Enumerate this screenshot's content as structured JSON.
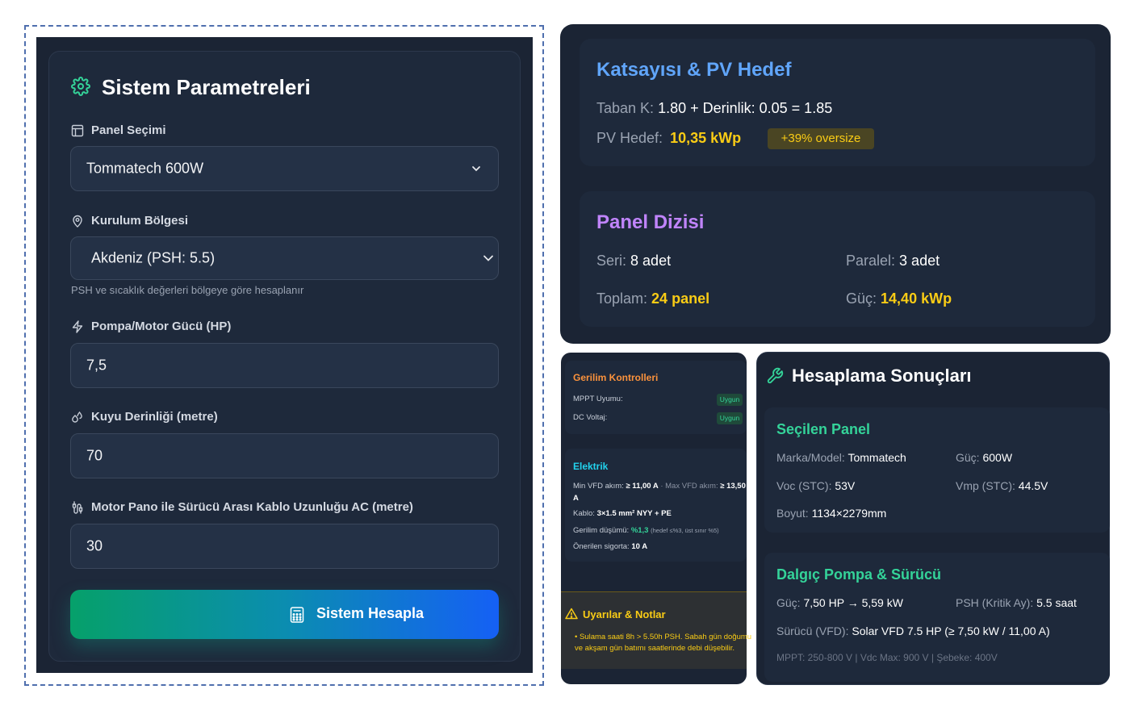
{
  "params": {
    "title": "Sistem Parametreleri",
    "panel": {
      "label": "Panel Seçimi",
      "value": "Tommatech 600W"
    },
    "region": {
      "label": "Kurulum Bölgesi",
      "value": "Akdeniz (PSH: 5.5)",
      "hint": "PSH ve sıcaklık değerleri bölgeye göre hesaplanır"
    },
    "pump": {
      "label": "Pompa/Motor Gücü (HP)",
      "value": "7,5"
    },
    "depth": {
      "label": "Kuyu Derinliği (metre)",
      "value": "70"
    },
    "cable": {
      "label": "Motor Pano ile Sürücü Arası Kablo Uzunluğu AC (metre)",
      "value": "30"
    },
    "button_label": "Sistem Hesapla"
  },
  "k_card": {
    "title": "Katsayısı & PV Hedef",
    "base_label": "Taban K:",
    "base_value": "1.80 + Derinlik: 0.05 = 1.85",
    "pv_label": "PV Hedef:",
    "pv_value": "10,35 kWp",
    "oversize": "+39% oversize"
  },
  "panel_array": {
    "title": "Panel Dizisi",
    "series_label": "Seri:",
    "series_value": "8 adet",
    "parallel_label": "Paralel:",
    "parallel_value": "3 adet",
    "total_label": "Toplam:",
    "total_value": "24 panel",
    "power_label": "Güç:",
    "power_value": "14,40 kWp"
  },
  "voltage": {
    "title": "Gerilim Kontrolleri",
    "mppt_label": "MPPT Uyumu:",
    "mppt_status": "Uygun",
    "dc_label": "DC Voltaj:",
    "dc_status": "Uygun"
  },
  "electric": {
    "title": "Elektrik",
    "vfd_min_label": "Min VFD akım:",
    "vfd_min_value": "≥ 11,00 A",
    "vfd_sep": "· Max VFD akım:",
    "vfd_max_value": "≥ 13,50",
    "vfd_unit": "A",
    "cable_label": "Kablo:",
    "cable_value": "3×1.5 mm² NYY + PE",
    "drop_label": "Gerilim düşümü:",
    "drop_value": "%1,3",
    "drop_note": "(hedef ≤%3, üst sınır %5)",
    "fuse_label": "Önerilen sigorta:",
    "fuse_value": "10 A"
  },
  "warnings": {
    "title": "Uyarılar & Notlar",
    "line1": "• Sulama saati 8h > 5.50h PSH. Sabah gün doğumu",
    "line2": "ve akşam gün batımı saatlerinde debi düşebilir."
  },
  "results": {
    "title": "Hesaplama Sonuçları",
    "selected": {
      "title": "Seçilen Panel",
      "brand_label": "Marka/Model:",
      "brand_value": "Tommatech",
      "power_label": "Güç:",
      "power_value": "600W",
      "voc_label": "Voc (STC):",
      "voc_value": "53V",
      "vmp_label": "Vmp (STC):",
      "vmp_value": "44.5V",
      "size_label": "Boyut:",
      "size_value": "1134×2279mm"
    },
    "pump": {
      "title": "Dalgıç Pompa & Sürücü",
      "power_label": "Güç:",
      "power_value": "7,50 HP → 5,59 kW",
      "psh_label": "PSH (Kritik Ay):",
      "psh_value": "5.5 saat",
      "vfd_label": "Sürücü (VFD):",
      "vfd_value": "Solar VFD 7.5 HP (≥ 7,50 kW / 11,00 A)",
      "footer": "MPPT: 250-800 V | Vdc Max: 900 V | Şebeke: 400V"
    }
  },
  "colors": {
    "accent_green": "#34d399",
    "accent_blue": "#60a5fa",
    "accent_purple": "#c084fc",
    "accent_yellow": "#facc15",
    "accent_orange": "#fb923c",
    "accent_cyan": "#22d3ee"
  }
}
